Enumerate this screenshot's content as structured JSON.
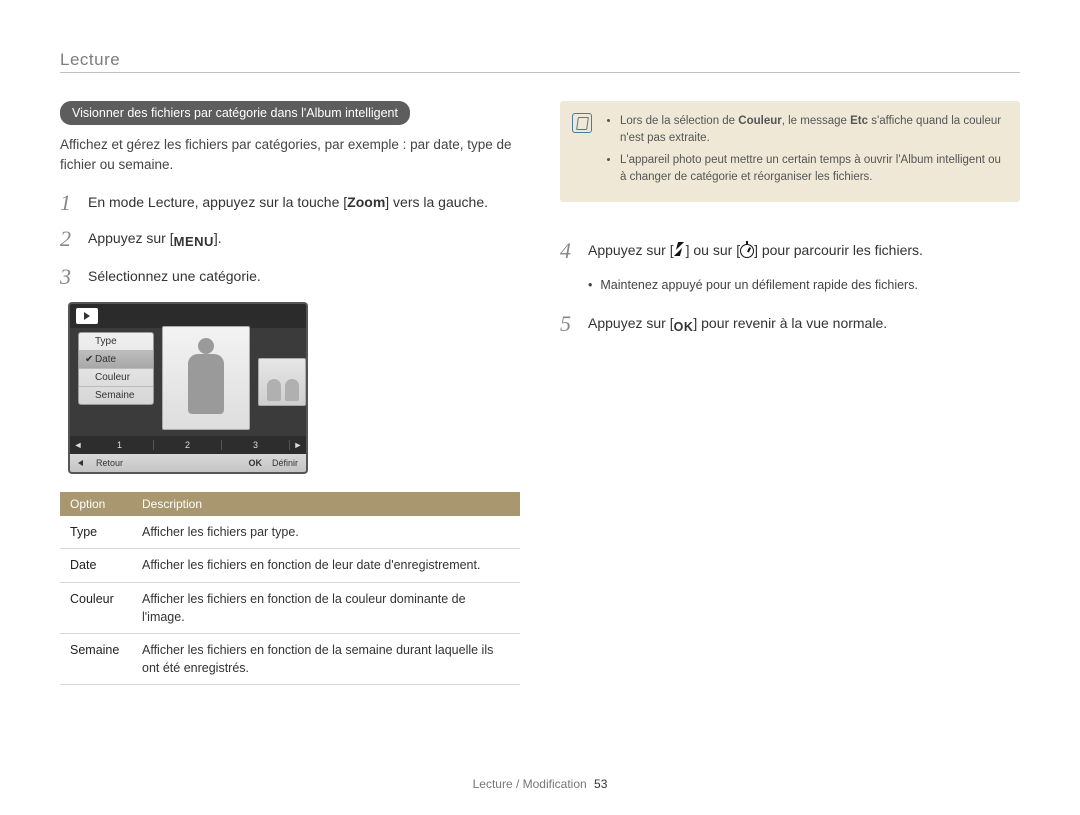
{
  "section_title": "Lecture",
  "left": {
    "pill": "Visionner des fichiers par catégorie dans l'Album intelligent",
    "intro": "Affichez et gérez les fichiers par catégories, par exemple : par date, type de fichier ou semaine.",
    "steps": {
      "s1_a": "En mode Lecture, appuyez sur la touche [",
      "s1_kw": "Zoom",
      "s1_b": "] vers la gauche.",
      "s2_a": "Appuyez sur [",
      "s2_icon": "MENU",
      "s2_b": "].",
      "s3": "Sélectionnez une catégorie."
    },
    "screen": {
      "menu": {
        "type": "Type",
        "date": "Date",
        "color": "Couleur",
        "week": "Semaine"
      },
      "pager": {
        "p1": "1",
        "p2": "2",
        "p3": "3"
      },
      "bar": {
        "back": "Retour",
        "ok": "OK",
        "set": "Définir"
      }
    },
    "table": {
      "h1": "Option",
      "h2": "Description",
      "rows": [
        {
          "opt": "Type",
          "desc": "Afficher les fichiers par type."
        },
        {
          "opt": "Date",
          "desc": "Afficher les fichiers en fonction de leur date d'enregistrement."
        },
        {
          "opt": "Couleur",
          "desc": "Afficher les fichiers en fonction de la couleur dominante de l'image."
        },
        {
          "opt": "Semaine",
          "desc": "Afficher les fichiers en fonction de la semaine durant laquelle ils ont été enregistrés."
        }
      ]
    }
  },
  "right": {
    "note": {
      "l1a": "Lors de la sélection de ",
      "l1b": "Couleur",
      "l1c": ", le message ",
      "l1d": "Etc",
      "l1e": " s'affiche quand la couleur n'est pas extraite.",
      "l2": "L'appareil photo peut mettre un certain temps à ouvrir l'Album intelligent ou à changer de catégorie et réorganiser les fichiers."
    },
    "steps": {
      "s4_a": "Appuyez sur [",
      "s4_mid": "] ou sur [",
      "s4_b": "] pour parcourir les fichiers.",
      "s4_sub": "Maintenez appuyé pour un défilement rapide des fichiers.",
      "s5_a": "Appuyez sur [",
      "s5_icon": "OK",
      "s5_b": "] pour revenir à la vue normale."
    }
  },
  "footer": {
    "path": "Lecture / Modification",
    "page": "53"
  }
}
